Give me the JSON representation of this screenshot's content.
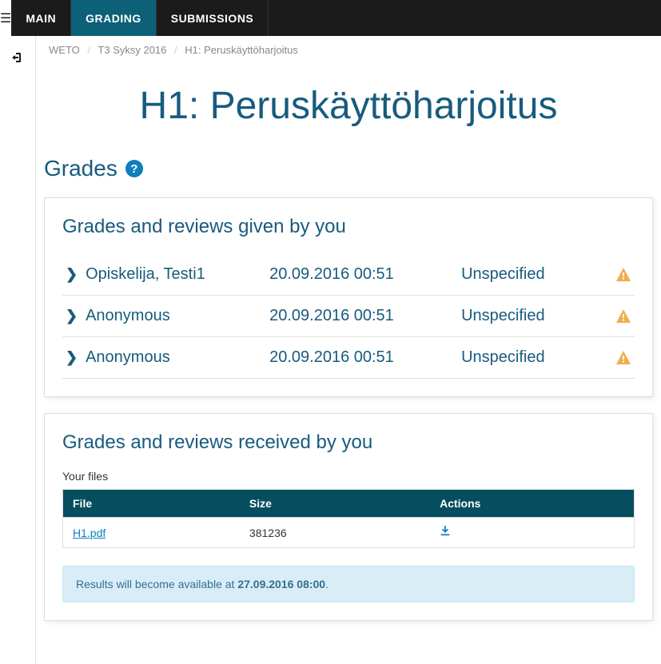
{
  "nav": {
    "tabs": [
      {
        "label": "MAIN"
      },
      {
        "label": "GRADING"
      },
      {
        "label": "SUBMISSIONS"
      }
    ]
  },
  "breadcrumb": {
    "root": "WETO",
    "course": "T3 Syksy 2016",
    "page": "H1: Peruskäyttöharjoitus"
  },
  "page_title": "H1: Peruskäyttöharjoitus",
  "grades_heading": "Grades",
  "help_symbol": "?",
  "given": {
    "title": "Grades and reviews given by you",
    "rows": [
      {
        "name": "Opiskelija, Testi1",
        "date": "20.09.2016 00:51",
        "status": "Unspecified"
      },
      {
        "name": "Anonymous",
        "date": "20.09.2016 00:51",
        "status": "Unspecified"
      },
      {
        "name": "Anonymous",
        "date": "20.09.2016 00:51",
        "status": "Unspecified"
      }
    ]
  },
  "received": {
    "title": "Grades and reviews received by you",
    "files_label": "Your files",
    "columns": {
      "file": "File",
      "size": "Size",
      "actions": "Actions"
    },
    "files": [
      {
        "name": "H1.pdf",
        "size": "381236"
      }
    ],
    "alert_prefix": "Results will become available at ",
    "alert_date": "27.09.2016 08:00",
    "alert_suffix": "."
  }
}
